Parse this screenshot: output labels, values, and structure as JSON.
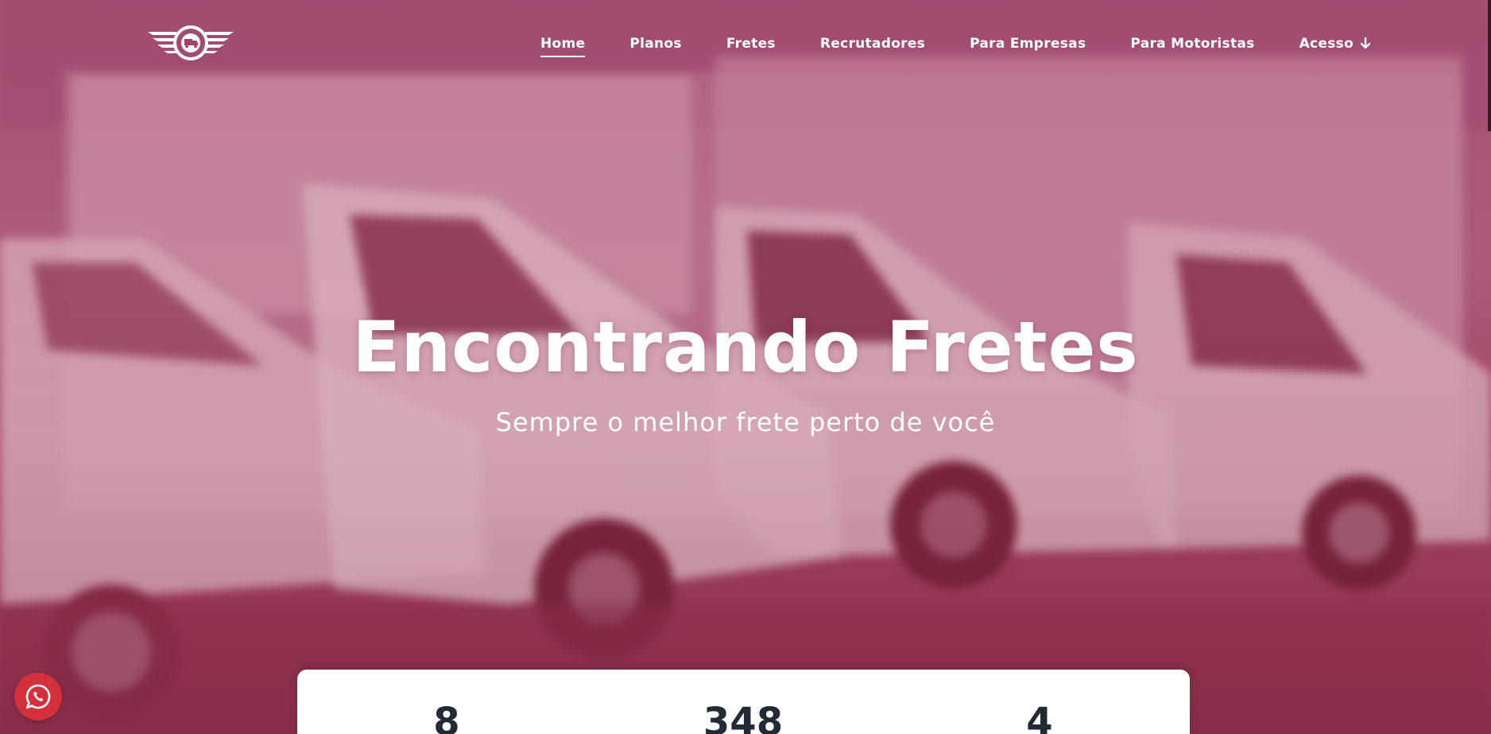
{
  "colors": {
    "overlay": "#a8406a",
    "nav_text": "#ffffff",
    "stat_text": "#222a35",
    "whatsapp": "#d3303c"
  },
  "logo": {
    "icon": "winged-truck-logo"
  },
  "nav": {
    "items": [
      {
        "label": "Home",
        "active": true
      },
      {
        "label": "Planos"
      },
      {
        "label": "Fretes"
      },
      {
        "label": "Recrutadores"
      },
      {
        "label": "Para Empresas"
      },
      {
        "label": "Para Motoristas"
      },
      {
        "label": "Acesso",
        "icon": "arrow-down-icon"
      }
    ]
  },
  "hero": {
    "title": "Encontrando Fretes",
    "subtitle": "Sempre o melhor frete perto de você"
  },
  "stats": {
    "values": [
      "8",
      "348",
      "4"
    ]
  },
  "whatsapp": {
    "icon": "whatsapp-icon"
  }
}
